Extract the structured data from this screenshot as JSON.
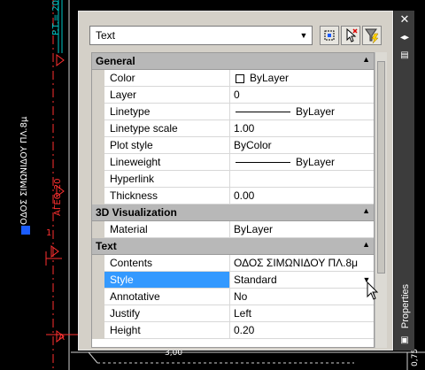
{
  "cad": {
    "vertical_text_cyan": "P.T.= 20",
    "vertical_text_1": "ΟΔΟΣ ΣΙΜΩΝΙΔΟΥ ΠΛ.8μ",
    "vertical_text_2": "ΑΓΕΘ.20",
    "vertical_text_3": "Α=ΑΑ",
    "marker_1": "1",
    "marker_a": "A",
    "bottom_text": "3,00",
    "bottom_right_text": "0,75"
  },
  "palette": {
    "title": "Properties",
    "object_type": "Text",
    "toolbar": {
      "select_objects_icon": "select-objects-icon",
      "pickadd_icon": "pickadd-toggle-icon",
      "quick_select_icon": "quick-select-icon"
    },
    "categories": [
      {
        "label": "General",
        "rows": [
          {
            "name": "Color",
            "value": "ByLayer",
            "kind": "color"
          },
          {
            "name": "Layer",
            "value": "0"
          },
          {
            "name": "Linetype",
            "value": "ByLayer",
            "kind": "line"
          },
          {
            "name": "Linetype scale",
            "value": "1.00"
          },
          {
            "name": "Plot style",
            "value": "ByColor"
          },
          {
            "name": "Lineweight",
            "value": "ByLayer",
            "kind": "line"
          },
          {
            "name": "Hyperlink",
            "value": ""
          },
          {
            "name": "Thickness",
            "value": "0.00"
          }
        ]
      },
      {
        "label": "3D Visualization",
        "rows": [
          {
            "name": "Material",
            "value": "ByLayer"
          }
        ]
      },
      {
        "label": "Text",
        "rows": [
          {
            "name": "Contents",
            "value": "ΟΔΟΣ ΣΙΜΩΝΙΔΟΥ ΠΛ.8μ"
          },
          {
            "name": "Style",
            "value": "Standard",
            "selected": true
          },
          {
            "name": "Annotative",
            "value": "No"
          },
          {
            "name": "Justify",
            "value": "Left"
          },
          {
            "name": "Height",
            "value": "0.20"
          }
        ]
      }
    ]
  },
  "colors": {
    "selection": "#3399ff",
    "category_bg": "#b8b8b8",
    "cad_red": "#ff3030",
    "cad_cyan": "#00c8c8",
    "cad_blue": "#1a5cff"
  }
}
